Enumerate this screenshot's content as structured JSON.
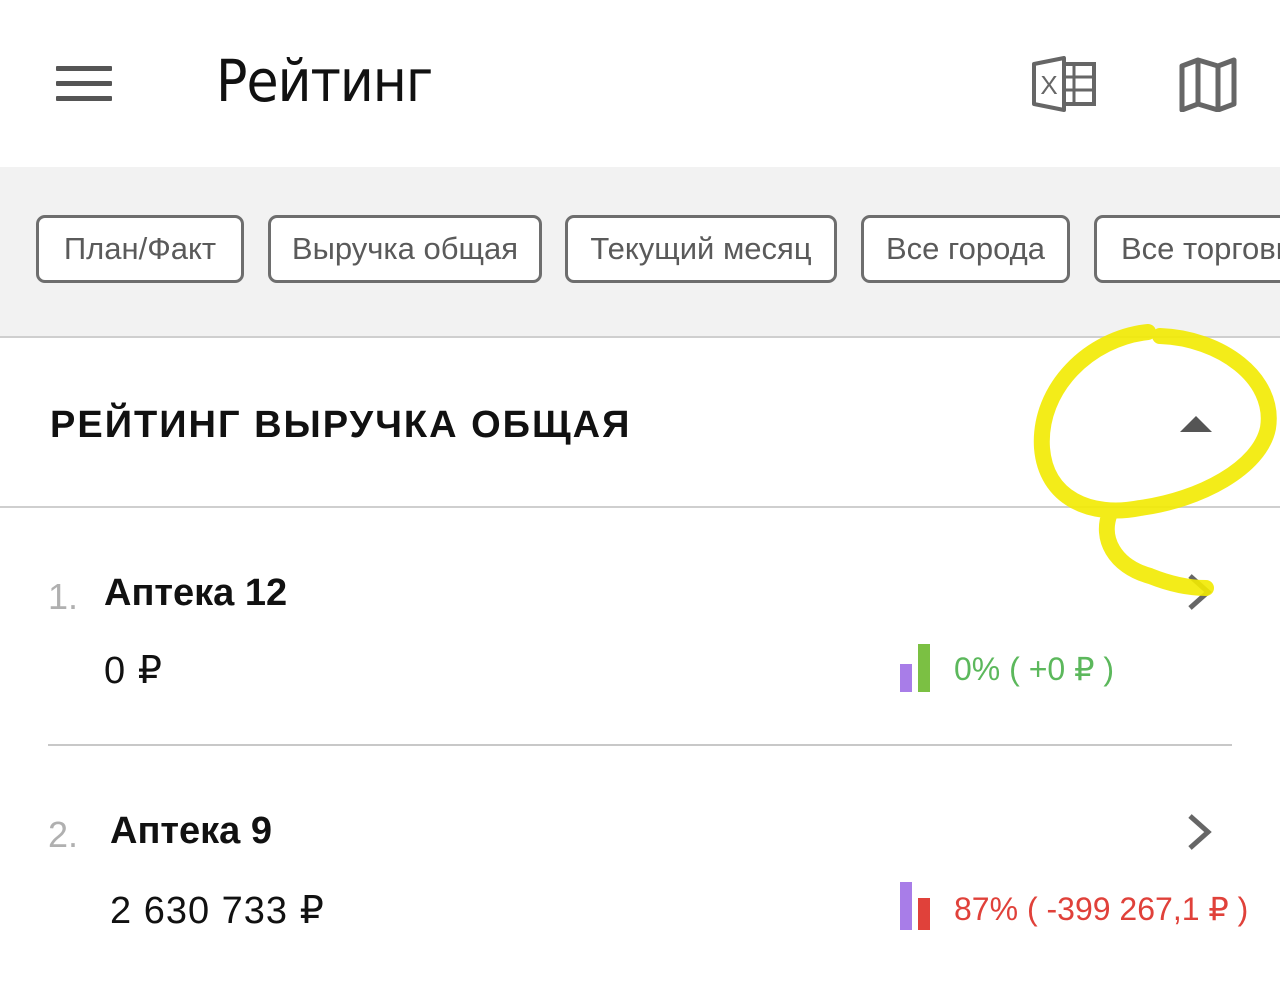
{
  "header": {
    "title": "Рейтинг",
    "menu_icon": "hamburger-menu-icon",
    "excel_icon": "excel-export-icon",
    "map_icon": "map-icon",
    "excel_letter": "X"
  },
  "filters": [
    {
      "label": "План/Факт"
    },
    {
      "label": "Выручка общая"
    },
    {
      "label": "Текущий месяц"
    },
    {
      "label": "Все города"
    },
    {
      "label": "Все торговы"
    }
  ],
  "section": {
    "title": "РЕЙТИНГ ВЫРУЧКА ОБЩАЯ",
    "toggle_icon": "caret-up-icon"
  },
  "items": [
    {
      "rank": "1.",
      "name": "Аптека 12",
      "amount": "0 ₽",
      "delta": "0% ( +0 ₽ )",
      "delta_color": "#5cb85c",
      "bar_colors": [
        "#a87de8",
        "#7bc043"
      ]
    },
    {
      "rank": "2.",
      "name": "Аптека 9",
      "amount": "2 630 733 ₽",
      "delta": "87% ( -399 267,1 ₽ )",
      "delta_color": "#e0413a",
      "bar_colors": [
        "#a87de8",
        "#e0413a"
      ]
    }
  ],
  "colors": {
    "annotation": "#f2ea00",
    "chip_border": "#6e6e6e",
    "filter_bg": "#f2f2f2"
  }
}
